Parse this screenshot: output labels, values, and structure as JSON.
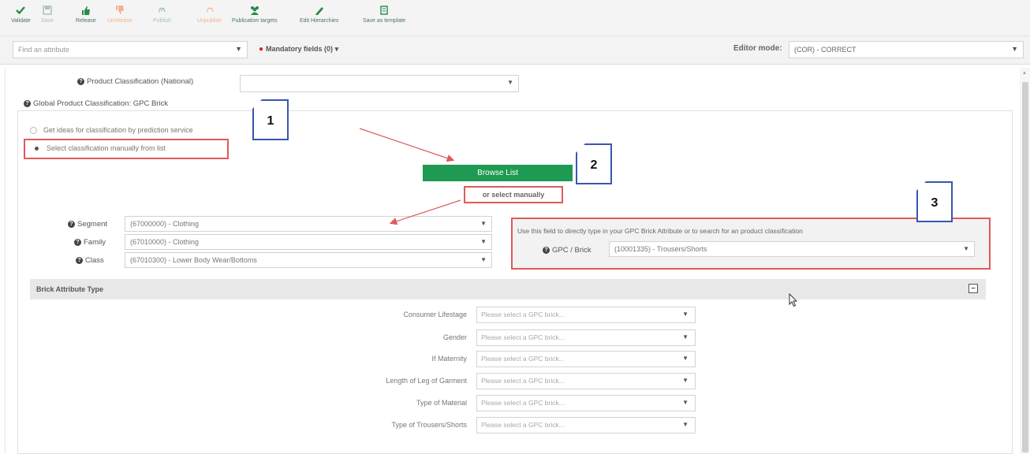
{
  "toolbar": {
    "items": [
      {
        "label": "Validate",
        "icon": "check-icon",
        "state": "enabled"
      },
      {
        "label": "Save",
        "icon": "save-icon",
        "state": "disabled"
      },
      {
        "label": "Release",
        "icon": "thumbs-up-icon",
        "state": "enabled"
      },
      {
        "label": "Unrelease",
        "icon": "thumbs-down-icon",
        "state": "disabled"
      },
      {
        "label": "Publish",
        "icon": "publish-icon",
        "state": "disabled"
      },
      {
        "label": "Unpublish",
        "icon": "unpublish-icon",
        "state": "disabled"
      },
      {
        "label": "Publication targets",
        "icon": "users-icon",
        "state": "enabled"
      },
      {
        "label": "Edit Hierarchies",
        "icon": "pencil-icon",
        "state": "enabled"
      },
      {
        "label": "Save as template",
        "icon": "template-icon",
        "state": "enabled"
      }
    ]
  },
  "subbar": {
    "find_placeholder": "Find an attribute",
    "mandatory": "Mandatory fields (0)",
    "editor_label": "Editor mode:",
    "editor_value": "(COR) - CORRECT"
  },
  "form": {
    "product_class_label": "Product Classification (National)",
    "global_class_label": "Global Product Classification: GPC Brick",
    "radio_predict": "Get ideas for classification by prediction service",
    "radio_manual": "Select classification manually from list",
    "browse_button": "Browse List",
    "or_select": "or select manually",
    "segment_label": "Segment",
    "segment_value": "(67000000) - Clothing",
    "family_label": "Family",
    "family_value": "(67010000) - Clothing",
    "class_label": "Class",
    "class_value": "(67010300) - Lower Body Wear/Bottoms",
    "gpc_hint": "Use this field to directly type in your GPC Brick Attribute or to search for an product classification",
    "gpc_label": "GPC / Brick",
    "gpc_value": "(10001335) - Trousers/Shorts",
    "brick_title": "Brick Attribute Type",
    "attr_placeholder": "Please select a GPC brick...",
    "attributes": [
      "Consumer Lifestage",
      "Gender",
      "If Maternity",
      "Length of Leg of Garment",
      "Type of Material",
      "Type of Trousers/Shorts"
    ]
  },
  "notes": [
    "1",
    "2",
    "3"
  ],
  "colors": {
    "accent_green": "#1e9a52",
    "annotation_red": "#e05a5a",
    "note_border": "#3a56b0"
  }
}
